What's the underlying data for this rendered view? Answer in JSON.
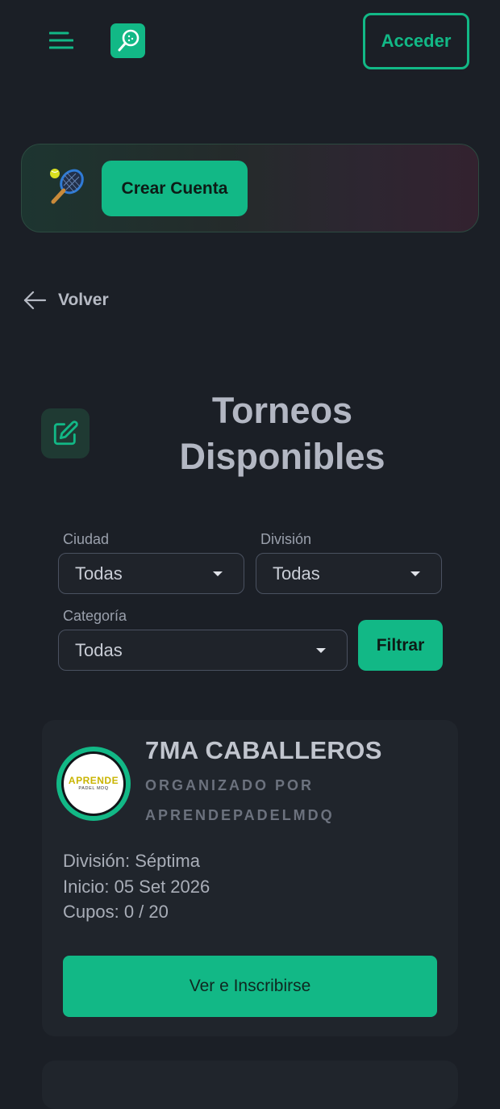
{
  "header": {
    "login_label": "Acceder",
    "menu_icon": "hamburger-icon",
    "logo_icon": "padel-racket-logo"
  },
  "banner": {
    "emoji": "🎾",
    "create_account_label": "Crear Cuenta"
  },
  "nav": {
    "back_label": "Volver"
  },
  "page": {
    "title_line1": "Torneos",
    "title_line2": "Disponibles",
    "title_icon": "edit-icon"
  },
  "filters": {
    "city": {
      "label": "Ciudad",
      "value": "Todas"
    },
    "division": {
      "label": "División",
      "value": "Todas"
    },
    "category": {
      "label": "Categoría",
      "value": "Todas"
    },
    "submit_label": "Filtrar"
  },
  "tournaments": [
    {
      "name": "7MA CABALLEROS",
      "organizer_line1": "ORGANIZADO POR",
      "organizer_line2": "APRENDEPADELMDQ",
      "logo_text": "APRENDE",
      "logo_subtext": "PADEL MDQ",
      "division": "División: Séptima",
      "start": "Inicio: 05 Set 2026",
      "spots": "Cupos: 0 / 20",
      "cta_label": "Ver e Inscribirse"
    }
  ],
  "colors": {
    "background": "#1b1f26",
    "accent": "#12b886",
    "card": "#20252c"
  }
}
